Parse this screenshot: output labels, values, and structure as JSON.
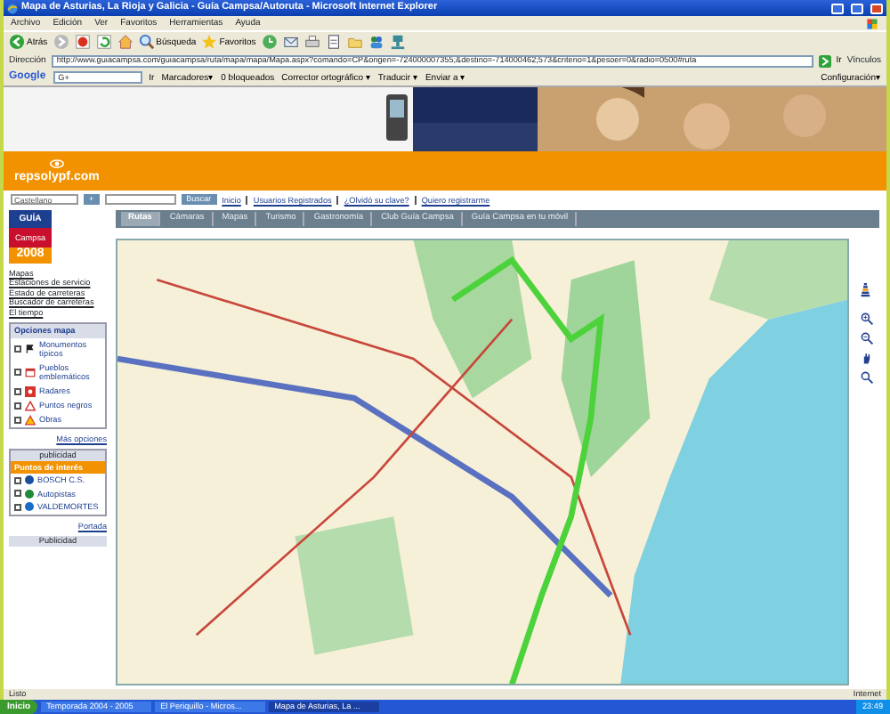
{
  "window": {
    "title": "Mapa de Asturias, La Rioja y Galicia - Guía Campsa/Autoruta - Microsoft Internet Explorer"
  },
  "menu": [
    "Archivo",
    "Edición",
    "Ver",
    "Favoritos",
    "Herramientas",
    "Ayuda"
  ],
  "toolbar": [
    {
      "kind": "back",
      "label": "Atrás"
    },
    {
      "kind": "forward"
    },
    {
      "kind": "stop"
    },
    {
      "kind": "refresh"
    },
    {
      "kind": "home"
    },
    {
      "kind": "search",
      "label": "Búsqueda"
    },
    {
      "kind": "favorites",
      "label": "Favoritos"
    },
    {
      "kind": "history"
    },
    {
      "kind": "mail"
    },
    {
      "kind": "print"
    },
    {
      "kind": "edit"
    },
    {
      "kind": "folder"
    },
    {
      "kind": "messenger"
    },
    {
      "kind": "network"
    }
  ],
  "address": {
    "label": "Dirección",
    "url": "http://www.guiacampsa.com/guiacampsa/ruta/mapa/mapa/Mapa.aspx?comando=CP&origen=-724000007355;&destino=-714000462;573&criterio=1&pesoer=0&radio=0500#ruta",
    "go": "Ir",
    "links": "Vínculos"
  },
  "google_bar": {
    "logo": "Google",
    "search_prefix": "G+",
    "go": "Ir",
    "items": [
      "Marcadores▾",
      "0 bloqueados",
      "Corrector ortográfico ▾",
      "Traducir ▾",
      "Enviar a ▾"
    ],
    "settings": "Configuración▾"
  },
  "site": {
    "logo": "repsolypf.com",
    "language": "Castellano",
    "add": "+",
    "search_button": "Buscar",
    "links": [
      "Inicio",
      "Usuarios Registrados",
      "¿Olvidó su clave?",
      "Quiero registrarme"
    ]
  },
  "tabs": [
    {
      "label": "Rutas",
      "selected": true
    },
    {
      "label": "Cámaras",
      "selected": false
    },
    {
      "label": "Mapas",
      "selected": false
    },
    {
      "label": "Turismo",
      "selected": false
    },
    {
      "label": "Gastronomía",
      "selected": false
    },
    {
      "label": "Club Guía Campsa",
      "selected": false
    },
    {
      "label": "Guía Campsa en tu móvil",
      "selected": false
    }
  ],
  "sidebar": {
    "guide": {
      "name": "GUÍA",
      "brand": "Campsa",
      "year": "2008"
    },
    "links": [
      "Mapas",
      "Estaciones de servicio",
      "Estado de carreteras",
      "Buscador de carreteras",
      "El tiempo"
    ],
    "options": {
      "title": "Opciones mapa",
      "items": [
        {
          "kind": "flag",
          "label": "Monumentos típicos",
          "checked": false
        },
        {
          "kind": "calendar",
          "label": "Pueblos emblemáticos",
          "checked": false
        },
        {
          "kind": "radar",
          "label": "Radares",
          "checked": false
        },
        {
          "kind": "warning",
          "label": "Puntos negros",
          "checked": false
        },
        {
          "kind": "works",
          "label": "Obras",
          "checked": false
        }
      ],
      "more": "Más opciones"
    },
    "ad_label": "publicidad",
    "poi": {
      "title": "Puntos de interés",
      "items": [
        {
          "label": "BOSCH C.S.",
          "color": "#1a4f9c",
          "checked": false
        },
        {
          "label": "Autopistas",
          "color": "#1f8a3a",
          "checked": false
        },
        {
          "label": "VALDEMORTES",
          "color": "#1a6fc4",
          "checked": false
        }
      ]
    },
    "footer_link": "Portada",
    "ad_label2": "Publicidad"
  },
  "status_bar": {
    "text": "Listo",
    "zone": "Internet"
  },
  "taskbar": {
    "start": "Inicio",
    "tasks": [
      {
        "label": "Temporada 2004 - 2005",
        "selected": false
      },
      {
        "label": "El Periquillo - Micros...",
        "selected": false
      },
      {
        "label": "Mapa de Asturias, La ...",
        "selected": true
      }
    ],
    "clock": "23:49"
  }
}
